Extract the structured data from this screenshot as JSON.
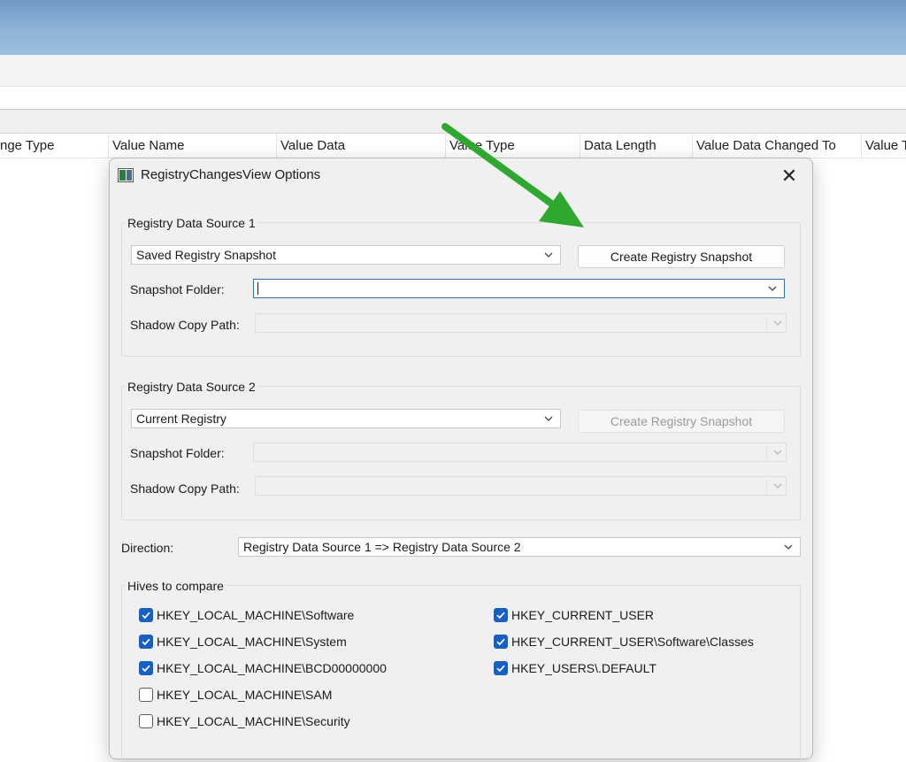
{
  "columns": [
    "nge Type",
    "Value Name",
    "Value Data",
    "Value Type",
    "Data Length",
    "Value Data Changed To",
    "Value T"
  ],
  "dialog": {
    "title": "RegistryChangesView Options",
    "close_icon": "close-icon",
    "source1": {
      "group_label": "Registry Data Source 1",
      "source_select": "Saved Registry Snapshot",
      "create_button": "Create Registry Snapshot",
      "snapshot_folder_label": "Snapshot Folder:",
      "snapshot_folder_value": "",
      "shadow_copy_label": "Shadow Copy Path:",
      "shadow_copy_value": ""
    },
    "source2": {
      "group_label": "Registry Data Source 2",
      "source_select": "Current Registry",
      "create_button": "Create Registry Snapshot",
      "snapshot_folder_label": "Snapshot Folder:",
      "snapshot_folder_value": "",
      "shadow_copy_label": "Shadow Copy Path:",
      "shadow_copy_value": ""
    },
    "direction": {
      "label": "Direction:",
      "value": "Registry Data Source 1 => Registry Data Source 2"
    },
    "hives": {
      "group_label": "Hives to compare",
      "left": [
        {
          "label": "HKEY_LOCAL_MACHINE\\Software",
          "checked": true
        },
        {
          "label": "HKEY_LOCAL_MACHINE\\System",
          "checked": true
        },
        {
          "label": "HKEY_LOCAL_MACHINE\\BCD00000000",
          "checked": true
        },
        {
          "label": "HKEY_LOCAL_MACHINE\\SAM",
          "checked": false
        },
        {
          "label": "HKEY_LOCAL_MACHINE\\Security",
          "checked": false
        }
      ],
      "right": [
        {
          "label": "HKEY_CURRENT_USER",
          "checked": true
        },
        {
          "label": "HKEY_CURRENT_USER\\Software\\Classes",
          "checked": true
        },
        {
          "label": "HKEY_USERS\\.DEFAULT",
          "checked": true
        }
      ]
    }
  },
  "colors": {
    "arrow": "#2fa82f",
    "checkbox_checked": "#1560c4",
    "focus_border": "#2f6fc2",
    "titlebar": "#8fb4d8"
  }
}
